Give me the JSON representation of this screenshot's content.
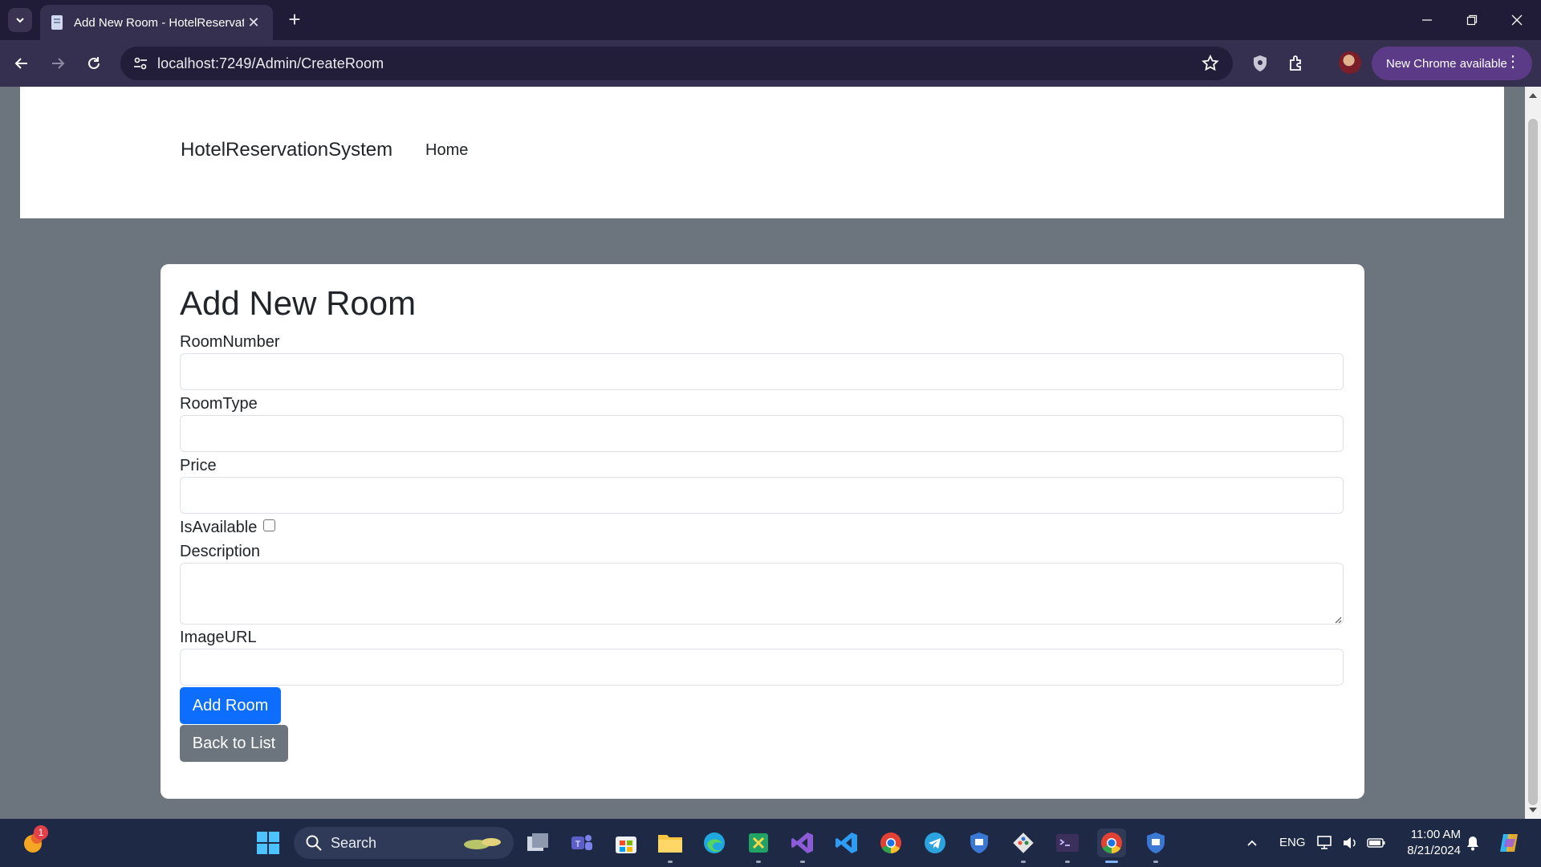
{
  "browser": {
    "tab_title": "Add New Room - HotelReservat",
    "url": "localhost:7249/Admin/CreateRoom",
    "update_label": "New Chrome available",
    "accent": "#5b3a87"
  },
  "site": {
    "brand": "HotelReservationSystem",
    "nav": [
      "Home"
    ]
  },
  "form": {
    "heading": "Add New Room",
    "fields": {
      "room_number_label": "RoomNumber",
      "room_type_label": "RoomType",
      "price_label": "Price",
      "is_available_label": "IsAvailable",
      "description_label": "Description",
      "image_url_label": "ImageURL"
    },
    "values": {
      "room_number": "",
      "room_type": "",
      "price": "",
      "description": "",
      "image_url": ""
    },
    "is_available_checked": false,
    "submit_label": "Add Room",
    "back_label": "Back to List",
    "colors": {
      "primary": "#0d6efd",
      "secondary": "#6c757d",
      "page_bg": "#6c757d"
    }
  },
  "taskbar": {
    "search_label": "Search",
    "notification_badge": "1",
    "language": "ENG",
    "time": "11:00 AM",
    "date": "8/21/2024",
    "apps": [
      "weather-icon",
      "windows-start-icon",
      "task-view-icon",
      "teams-icon",
      "microsoft-store-icon",
      "file-explorer-icon",
      "edge-icon",
      "excel-icon",
      "visual-studio-icon",
      "vscode-icon",
      "chrome-icon",
      "telegram-icon",
      "security-icon",
      "git-icon",
      "terminal-icon",
      "chrome-active-icon",
      "defender-icon"
    ]
  }
}
